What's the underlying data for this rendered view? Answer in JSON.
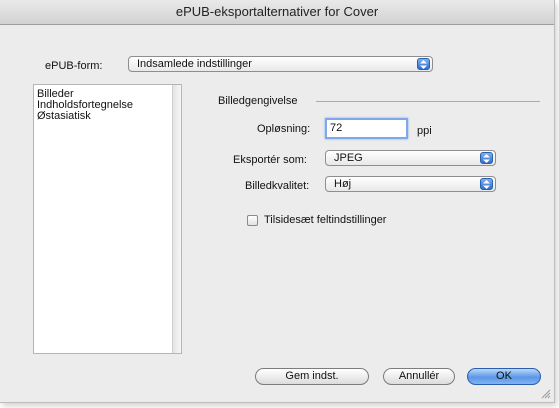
{
  "window": {
    "title": "ePUB-eksportalternativer for Cover"
  },
  "preset": {
    "label": "ePUB-form:",
    "value": "Indsamlede indstillinger"
  },
  "sidebar": {
    "items": [
      {
        "label": "Billeder"
      },
      {
        "label": "Indholdsfortegnelse"
      },
      {
        "label": "Østasiatisk"
      }
    ]
  },
  "images": {
    "group_title": "Billedgengivelse",
    "resolution_label": "Opløsning:",
    "resolution_value": "72",
    "resolution_unit": "ppi",
    "export_label": "Eksportér som:",
    "export_value": "JPEG",
    "quality_label": "Billedkvalitet:",
    "quality_value": "Høj",
    "override_label": "Tilsidesæt feltindstillinger",
    "override_checked": false
  },
  "buttons": {
    "save": "Gem indst.",
    "cancel": "Annullér",
    "ok": "OK"
  },
  "colors": {
    "accent": "#3b7ee0",
    "window_bg": "#ececec"
  },
  "icons": {
    "popup_arrows": "up-down-arrows-icon",
    "resize": "resize-grip-icon"
  }
}
